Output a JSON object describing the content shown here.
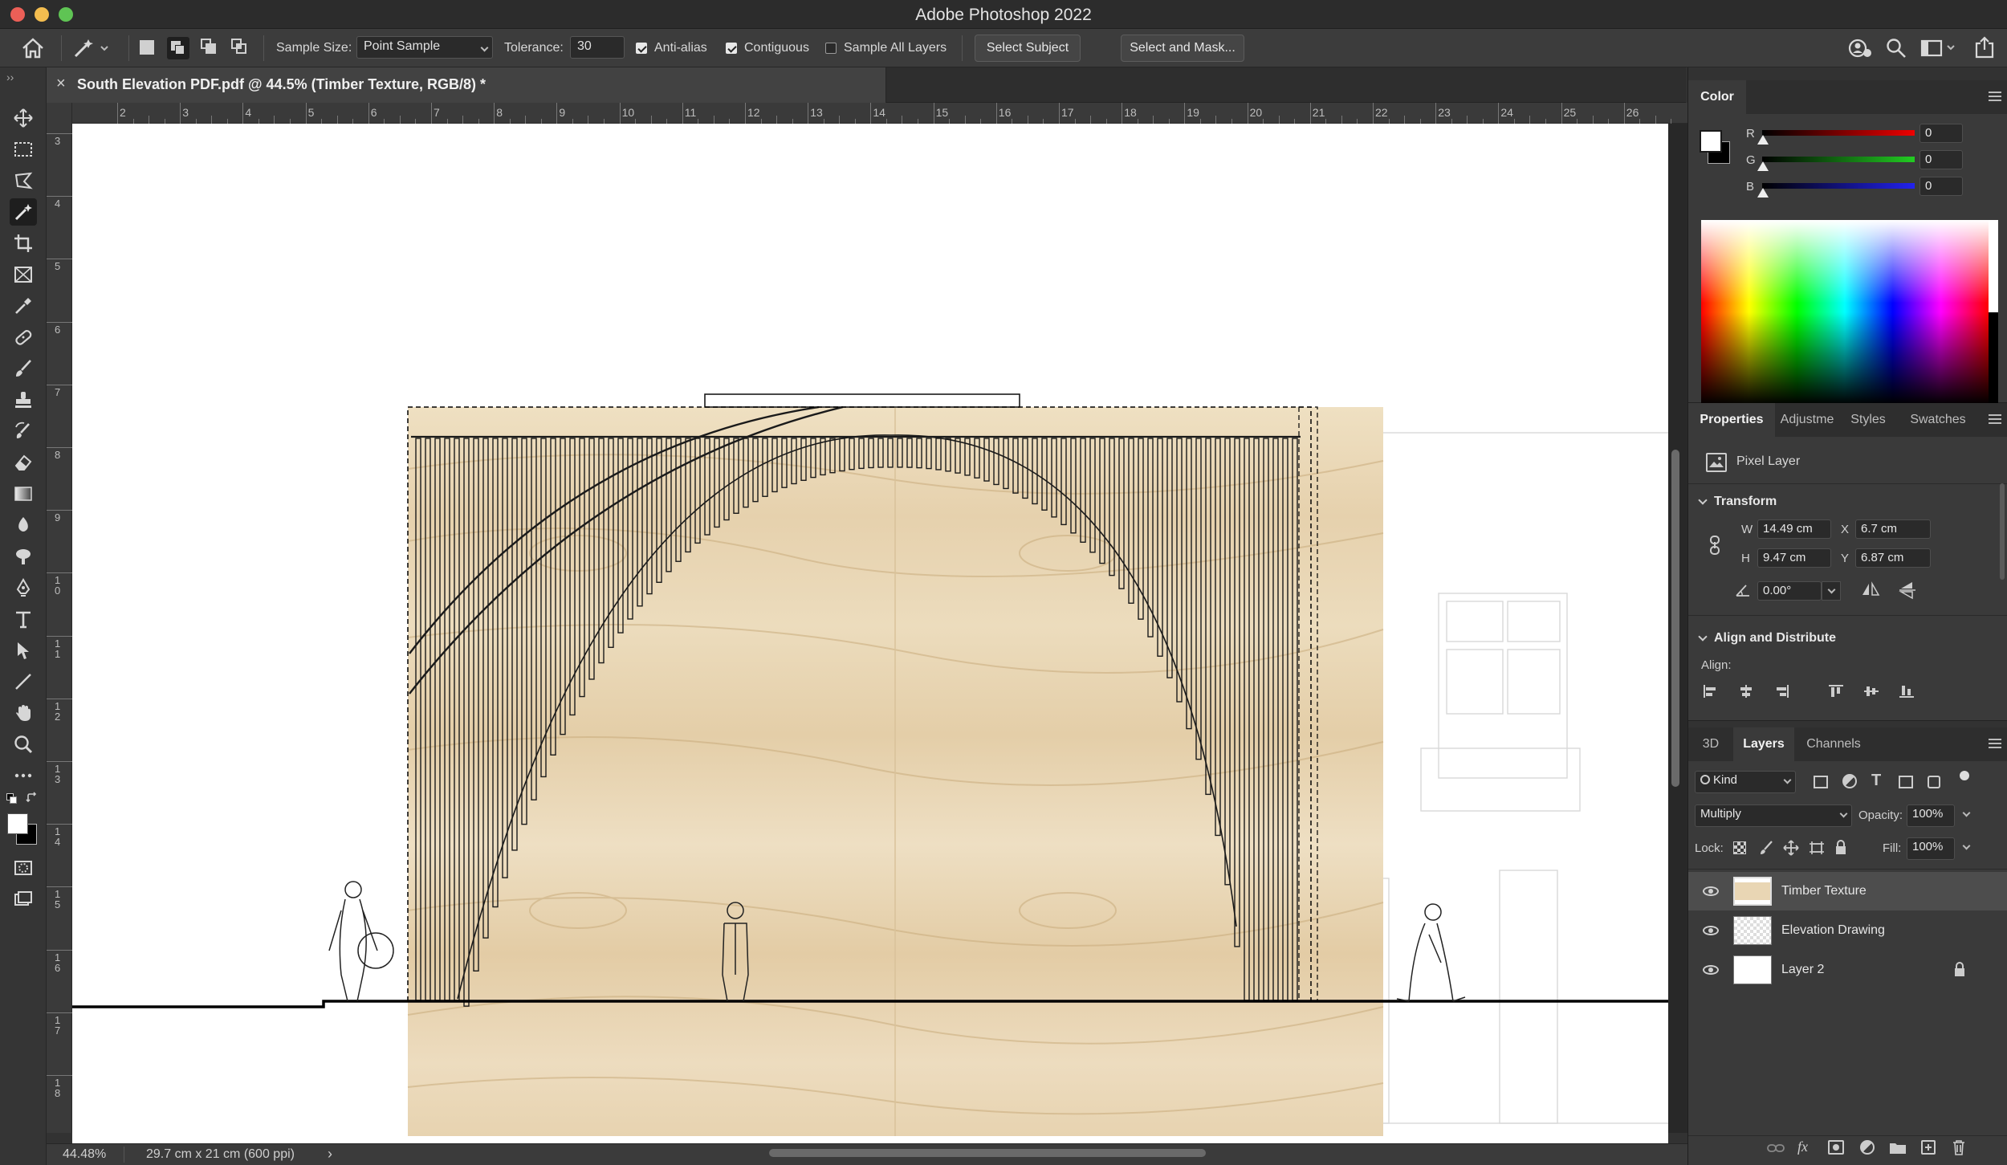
{
  "window": {
    "title": "Adobe Photoshop 2022"
  },
  "options_bar": {
    "sample_size_label": "Sample Size:",
    "sample_size_value": "Point Sample",
    "tolerance_label": "Tolerance:",
    "tolerance_value": "30",
    "anti_alias_label": "Anti-alias",
    "anti_alias_checked": true,
    "contiguous_label": "Contiguous",
    "contiguous_checked": true,
    "sample_all_layers_label": "Sample All Layers",
    "sample_all_layers_checked": false,
    "select_subject_label": "Select Subject",
    "select_and_mask_label": "Select and Mask..."
  },
  "document": {
    "tab_title": "South Elevation PDF.pdf @ 44.5% (Timber Texture, RGB/8) *",
    "close_glyph": "×"
  },
  "rulers": {
    "horizontal": [
      "2",
      "3",
      "4",
      "5",
      "6",
      "7",
      "8",
      "9",
      "10",
      "11",
      "12",
      "13",
      "14",
      "15",
      "16",
      "17",
      "18",
      "19",
      "20",
      "21",
      "22",
      "23",
      "24",
      "25",
      "26"
    ],
    "vertical": [
      "3",
      "4",
      "5",
      "6",
      "7",
      "8",
      "9",
      "1\n0",
      "1\n1",
      "1\n2",
      "1\n3",
      "1\n4",
      "1\n5",
      "1\n6",
      "1\n7",
      "1\n8"
    ]
  },
  "status_bar": {
    "zoom": "44.48%",
    "doc_info": "29.7 cm x 21 cm (600 ppi)",
    "arrow": "›"
  },
  "color_panel": {
    "title": "Color",
    "r_label": "R",
    "g_label": "G",
    "b_label": "B",
    "r_value": "0",
    "g_value": "0",
    "b_value": "0",
    "foreground": "#ffffff",
    "background": "#000000"
  },
  "properties_panel": {
    "tabs": [
      "Properties",
      "Adjustme",
      "Styles",
      "Swatches"
    ],
    "active_tab": "Properties",
    "layer_kind": "Pixel Layer",
    "transform_title": "Transform",
    "w_label": "W",
    "w_value": "14.49 cm",
    "x_label": "X",
    "x_value": "6.7 cm",
    "h_label": "H",
    "h_value": "9.47 cm",
    "y_label": "Y",
    "y_value": "6.87 cm",
    "angle_value": "0.00°",
    "align_title": "Align and Distribute",
    "align_label": "Align:"
  },
  "layers_panel": {
    "tabs": [
      "3D",
      "Layers",
      "Channels"
    ],
    "active_tab": "Layers",
    "kind_label": "Kind",
    "blend_mode": "Multiply",
    "opacity_label": "Opacity:",
    "opacity_value": "100%",
    "lock_label": "Lock:",
    "fill_label": "Fill:",
    "fill_value": "100%",
    "layers": [
      {
        "name": "Timber Texture",
        "selected": true,
        "locked": false
      },
      {
        "name": "Elevation Drawing",
        "selected": false,
        "locked": false
      },
      {
        "name": "Layer 2",
        "selected": false,
        "locked": true
      }
    ]
  },
  "colors": {
    "app_bg": "#323232",
    "accent_selected": "#4a4a4a",
    "timber": "#e9d6b4"
  }
}
